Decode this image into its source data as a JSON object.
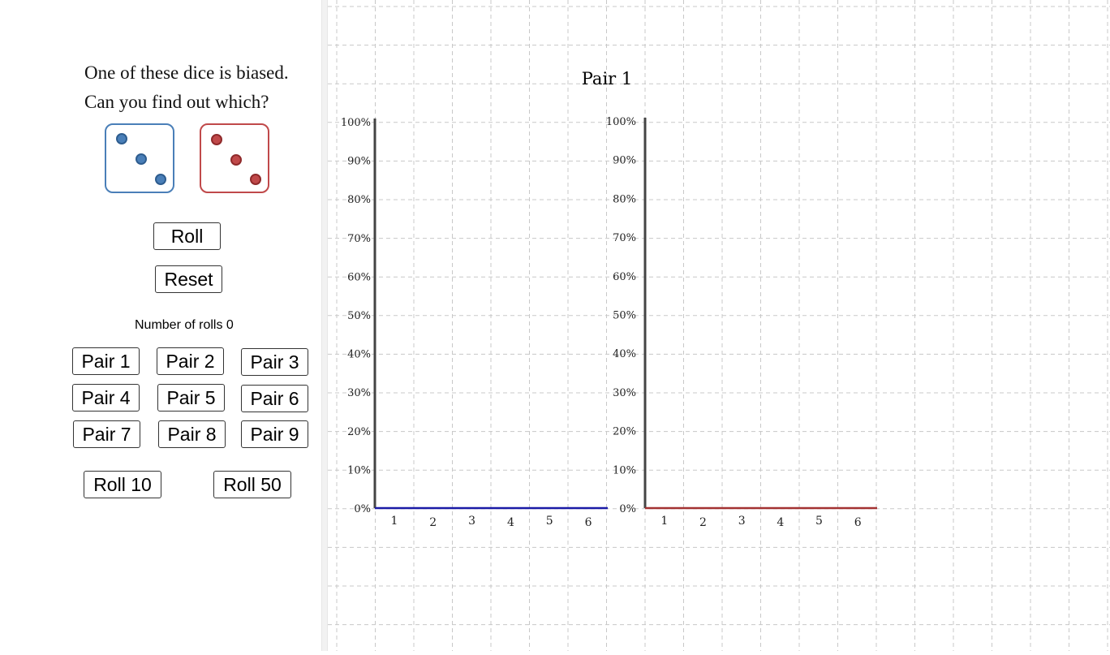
{
  "prompt": {
    "line1": "One of these dice is biased.",
    "line2": "Can you find out which?"
  },
  "dice": {
    "blue": {
      "value": 3,
      "color": "#4a7fb8"
    },
    "red": {
      "value": 3,
      "color": "#c0494a"
    }
  },
  "controls": {
    "roll_label": "Roll",
    "reset_label": "Reset",
    "rolls_text": "Number of rolls 0",
    "pairs": [
      "Pair 1",
      "Pair 2",
      "Pair 3",
      "Pair 4",
      "Pair 5",
      "Pair 6",
      "Pair 7",
      "Pair 8",
      "Pair 9"
    ],
    "roll10_label": "Roll 10",
    "roll50_label": "Roll 50"
  },
  "graph_title": "Pair 1",
  "chart_data": [
    {
      "type": "bar",
      "categories": [
        "1",
        "2",
        "3",
        "4",
        "5",
        "6"
      ],
      "values": [
        0,
        0,
        0,
        0,
        0,
        0
      ],
      "yticks": [
        "0%",
        "10%",
        "20%",
        "30%",
        "40%",
        "50%",
        "60%",
        "70%",
        "80%",
        "90%",
        "100%"
      ],
      "ylim": [
        0,
        100
      ],
      "color": "#1a1aa6"
    },
    {
      "type": "bar",
      "categories": [
        "1",
        "2",
        "3",
        "4",
        "5",
        "6"
      ],
      "values": [
        0,
        0,
        0,
        0,
        0,
        0
      ],
      "yticks": [
        "0%",
        "10%",
        "20%",
        "30%",
        "40%",
        "50%",
        "60%",
        "70%",
        "80%",
        "90%",
        "100%"
      ],
      "ylim": [
        0,
        100
      ],
      "color": "#a33232"
    }
  ]
}
